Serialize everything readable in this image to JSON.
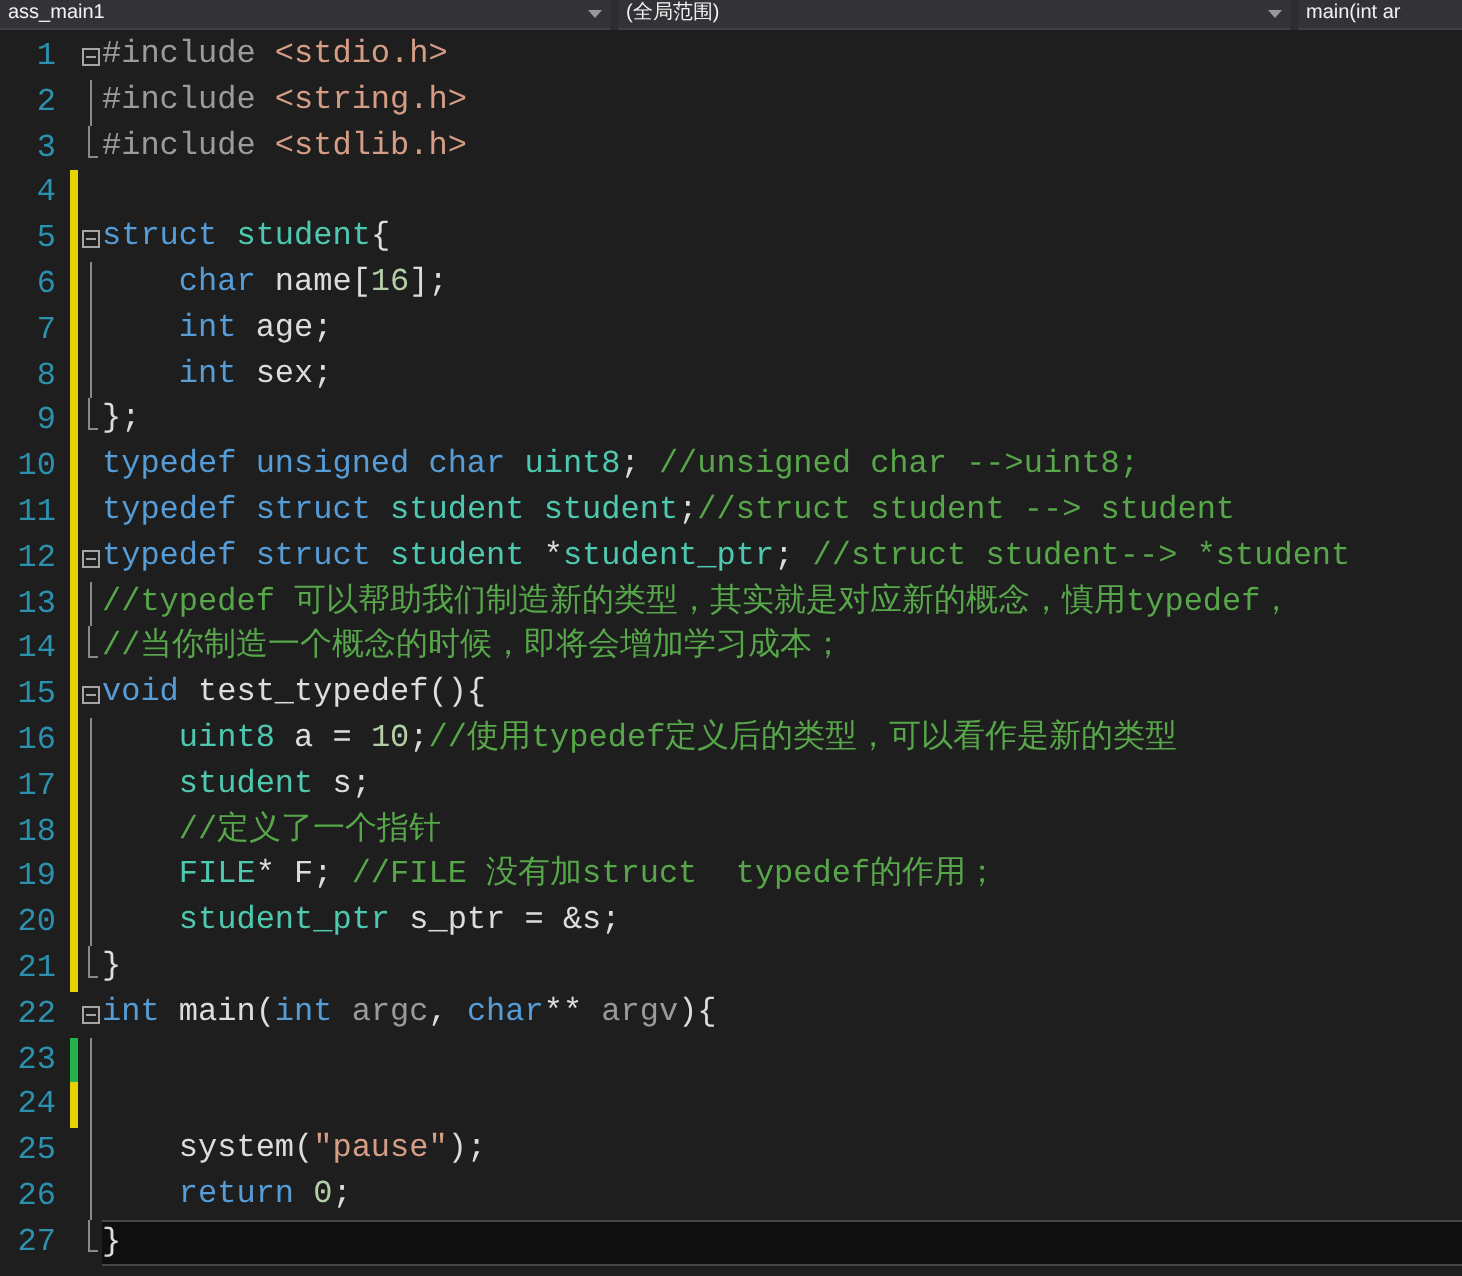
{
  "navigation_bar": {
    "dropdowns": [
      {
        "label": "ass_main1"
      },
      {
        "label": "(全局范围)"
      },
      {
        "label": "main(int ar"
      }
    ]
  },
  "editor": {
    "lines": [
      {
        "number": "1",
        "modified": false,
        "fold_start": true,
        "fold_end": false,
        "current": false,
        "tokens": [
          {
            "text": "#include ",
            "kind": "preproc"
          },
          {
            "text": "<stdio.h>",
            "kind": "string"
          }
        ]
      },
      {
        "number": "2",
        "modified": false,
        "fold_start": false,
        "fold_end": false,
        "current": false,
        "tokens": [
          {
            "text": "#include ",
            "kind": "preproc"
          },
          {
            "text": "<string.h>",
            "kind": "string"
          }
        ]
      },
      {
        "number": "3",
        "modified": false,
        "fold_start": false,
        "fold_end": true,
        "current": false,
        "tokens": [
          {
            "text": "#include ",
            "kind": "preproc"
          },
          {
            "text": "<stdlib.h>",
            "kind": "string"
          }
        ]
      },
      {
        "number": "4",
        "modified": true,
        "saved": false,
        "fold_start": false,
        "fold_end": false,
        "current": false
      },
      {
        "number": "5",
        "modified": true,
        "saved": false,
        "fold_start": true,
        "fold_end": false,
        "current": false,
        "tokens": [
          {
            "text": "struct ",
            "kind": "keyword"
          },
          {
            "text": "student",
            "kind": "type"
          },
          {
            "text": "{",
            "kind": "plain"
          }
        ]
      },
      {
        "number": "6",
        "modified": true,
        "saved": false,
        "fold_start": false,
        "fold_end": false,
        "current": false,
        "tokens": [
          {
            "text": "    char",
            "kind": "keyword"
          },
          {
            "text": " name[",
            "kind": "plain"
          },
          {
            "text": "16",
            "kind": "number"
          },
          {
            "text": "];",
            "kind": "plain"
          }
        ]
      },
      {
        "number": "7",
        "modified": true,
        "saved": false,
        "fold_start": false,
        "fold_end": false,
        "current": false,
        "tokens": [
          {
            "text": "    int",
            "kind": "keyword"
          },
          {
            "text": " age;",
            "kind": "plain"
          }
        ]
      },
      {
        "number": "8",
        "modified": true,
        "saved": false,
        "fold_start": false,
        "fold_end": false,
        "current": false,
        "tokens": [
          {
            "text": "    int",
            "kind": "keyword"
          },
          {
            "text": " sex;",
            "kind": "plain"
          }
        ]
      },
      {
        "number": "9",
        "modified": true,
        "saved": false,
        "fold_start": false,
        "fold_end": true,
        "current": false,
        "tokens": [
          {
            "text": "};",
            "kind": "plain"
          }
        ]
      },
      {
        "number": "10",
        "modified": true,
        "saved": false,
        "fold_start": false,
        "fold_end": false,
        "current": false,
        "tokens": [
          {
            "text": "typedef unsigned char ",
            "kind": "keyword"
          },
          {
            "text": "uint8",
            "kind": "type"
          },
          {
            "text": "; ",
            "kind": "plain"
          },
          {
            "text": "//unsigned char -->uint8;",
            "kind": "comment"
          }
        ]
      },
      {
        "number": "11",
        "modified": true,
        "saved": false,
        "fold_start": false,
        "fold_end": false,
        "current": false,
        "tokens": [
          {
            "text": "typedef struct ",
            "kind": "keyword"
          },
          {
            "text": "student student",
            "kind": "type"
          },
          {
            "text": ";",
            "kind": "plain"
          },
          {
            "text": "//struct student --> student",
            "kind": "comment"
          }
        ]
      },
      {
        "number": "12",
        "modified": true,
        "saved": false,
        "fold_start": true,
        "fold_end": false,
        "current": false,
        "tokens": [
          {
            "text": "typedef struct ",
            "kind": "keyword"
          },
          {
            "text": "student",
            "kind": "type"
          },
          {
            "text": " *",
            "kind": "plain"
          },
          {
            "text": "student_ptr",
            "kind": "type"
          },
          {
            "text": "; ",
            "kind": "plain"
          },
          {
            "text": "//struct student--> *student",
            "kind": "comment"
          }
        ]
      },
      {
        "number": "13",
        "modified": true,
        "saved": false,
        "fold_start": false,
        "fold_end": false,
        "current": false,
        "tokens": [
          {
            "text": "//typedef 可以帮助我们制造新的类型，其实就是对应新的概念，慎用typedef，",
            "kind": "comment"
          }
        ]
      },
      {
        "number": "14",
        "modified": true,
        "saved": false,
        "fold_start": false,
        "fold_end": true,
        "current": false,
        "tokens": [
          {
            "text": "//当你制造一个概念的时候，即将会增加学习成本；",
            "kind": "comment"
          }
        ]
      },
      {
        "number": "15",
        "modified": true,
        "saved": false,
        "fold_start": true,
        "fold_end": false,
        "current": false,
        "tokens": [
          {
            "text": "void",
            "kind": "keyword"
          },
          {
            "text": " test_typedef(){",
            "kind": "plain"
          }
        ]
      },
      {
        "number": "16",
        "modified": true,
        "saved": false,
        "fold_start": false,
        "fold_end": false,
        "current": false,
        "tokens": [
          {
            "text": "    uint8",
            "kind": "type"
          },
          {
            "text": " a = ",
            "kind": "plain"
          },
          {
            "text": "10",
            "kind": "number"
          },
          {
            "text": ";",
            "kind": "plain"
          },
          {
            "text": "//使用typedef定义后的类型，可以看作是新的类型",
            "kind": "comment"
          }
        ]
      },
      {
        "number": "17",
        "modified": true,
        "saved": false,
        "fold_start": false,
        "fold_end": false,
        "current": false,
        "tokens": [
          {
            "text": "    student",
            "kind": "type"
          },
          {
            "text": " s;",
            "kind": "plain"
          }
        ]
      },
      {
        "number": "18",
        "modified": true,
        "saved": false,
        "fold_start": false,
        "fold_end": false,
        "current": false,
        "tokens": [
          {
            "text": "    //定义了一个指针",
            "kind": "comment"
          }
        ]
      },
      {
        "number": "19",
        "modified": true,
        "saved": false,
        "fold_start": false,
        "fold_end": false,
        "current": false,
        "tokens": [
          {
            "text": "    FILE",
            "kind": "type"
          },
          {
            "text": "* F; ",
            "kind": "plain"
          },
          {
            "text": "//FILE 没有加struct  typedef的作用；",
            "kind": "comment"
          }
        ]
      },
      {
        "number": "20",
        "modified": true,
        "saved": false,
        "fold_start": false,
        "fold_end": false,
        "current": false,
        "tokens": [
          {
            "text": "    student_ptr",
            "kind": "type"
          },
          {
            "text": " s_ptr = &s;",
            "kind": "plain"
          }
        ]
      },
      {
        "number": "21",
        "modified": true,
        "saved": false,
        "fold_start": false,
        "fold_end": true,
        "current": false,
        "tokens": [
          {
            "text": "}",
            "kind": "plain"
          }
        ]
      },
      {
        "number": "22",
        "modified": false,
        "fold_start": true,
        "fold_end": false,
        "current": false,
        "tokens": [
          {
            "text": "int",
            "kind": "keyword"
          },
          {
            "text": " main(",
            "kind": "plain"
          },
          {
            "text": "int",
            "kind": "keyword"
          },
          {
            "text": " argc",
            "kind": "param"
          },
          {
            "text": ", ",
            "kind": "plain"
          },
          {
            "text": "char",
            "kind": "keyword"
          },
          {
            "text": "** ",
            "kind": "plain"
          },
          {
            "text": "argv",
            "kind": "param"
          },
          {
            "text": "){",
            "kind": "plain"
          }
        ]
      },
      {
        "number": "23",
        "modified": true,
        "saved": true,
        "fold_start": false,
        "fold_end": false,
        "current": false
      },
      {
        "number": "24",
        "modified": true,
        "saved": false,
        "fold_start": false,
        "fold_end": false,
        "current": false
      },
      {
        "number": "25",
        "modified": false,
        "fold_start": false,
        "fold_end": false,
        "current": false,
        "tokens": [
          {
            "text": "    system(",
            "kind": "plain"
          },
          {
            "text": "\"pause\"",
            "kind": "string"
          },
          {
            "text": ");",
            "kind": "plain"
          }
        ]
      },
      {
        "number": "26",
        "modified": false,
        "fold_start": false,
        "fold_end": false,
        "current": false,
        "tokens": [
          {
            "text": "    return",
            "kind": "keyword"
          },
          {
            "text": " 0",
            "kind": "number"
          },
          {
            "text": ";",
            "kind": "plain"
          }
        ]
      },
      {
        "number": "27",
        "modified": false,
        "fold_start": false,
        "fold_end": true,
        "current": true,
        "tokens": [
          {
            "text": "}",
            "kind": "plain"
          }
        ]
      }
    ]
  }
}
